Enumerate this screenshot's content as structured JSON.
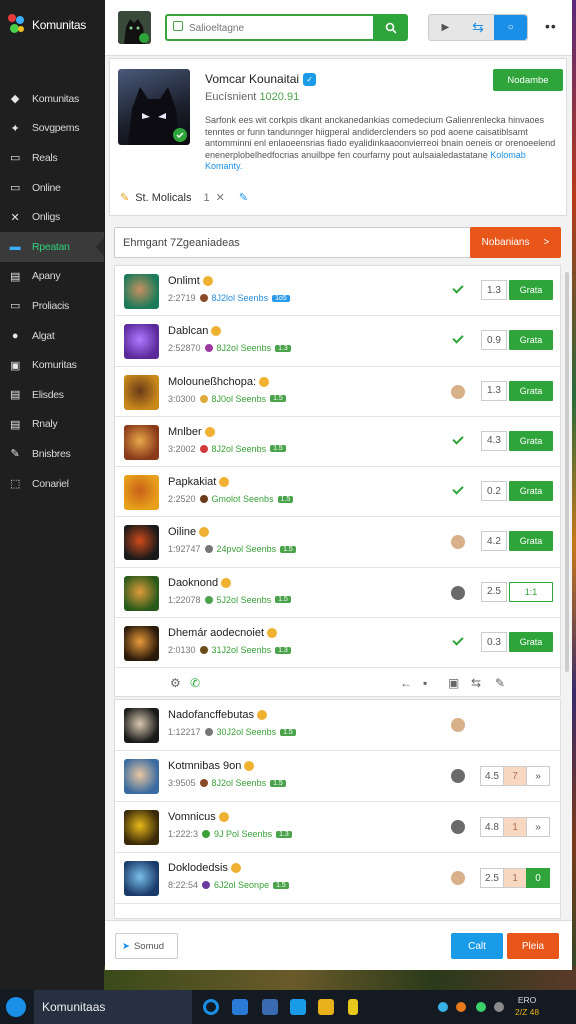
{
  "app": {
    "name": "Komunitas"
  },
  "sidebar": {
    "items": [
      {
        "label": "Komunitas",
        "icon": "pin-icon",
        "glyph": "◆"
      },
      {
        "label": "Sovgpems",
        "icon": "upload-icon",
        "glyph": "✦"
      },
      {
        "label": "Reals",
        "icon": "square-icon",
        "glyph": "▭"
      },
      {
        "label": "Online",
        "icon": "window-icon",
        "glyph": "▭"
      },
      {
        "label": "Onligs",
        "icon": "tools-icon",
        "glyph": "✕"
      },
      {
        "label": "Rpeatan",
        "icon": "card-icon",
        "glyph": "▬",
        "active": true
      },
      {
        "label": "Apany",
        "icon": "list-icon",
        "glyph": "▤"
      },
      {
        "label": "Proliacis",
        "icon": "frame-icon",
        "glyph": "▭"
      },
      {
        "label": "Algat",
        "icon": "circle-icon",
        "glyph": "●"
      },
      {
        "label": "Komuritas",
        "icon": "box-icon",
        "glyph": "▣"
      },
      {
        "label": "Elisdes",
        "icon": "layers-icon",
        "glyph": "▤"
      },
      {
        "label": "Rnaly",
        "icon": "doc-icon",
        "glyph": "▤"
      },
      {
        "label": "Bnisbres",
        "icon": "wand-icon",
        "glyph": "✎"
      },
      {
        "label": "Conariel",
        "icon": "tag-icon",
        "glyph": "⬚"
      }
    ]
  },
  "topbar": {
    "search_placeholder": "Salioeltagne",
    "search_icon": "search-icon",
    "toggle_icons": [
      "play-icon",
      "swap-icon",
      "circle-icon"
    ],
    "more_label": "••"
  },
  "profile": {
    "title": "Vomcar Kounaitai",
    "subtitle_prefix": "Eucísnient",
    "subtitle_value": "1020.91",
    "follow_label": "Nodambe",
    "description": "Sarfonk ees wit corkpis dkant anckanedankias comedecium Galienrenlecka hinvaoes tenntes or funn tandunnger hiigperal andiderclenders so pod aoene caisatiblsamt antomminni enl enlaoeensrias fiado eyalidinkaaoonvierreoi bnain oeneis or orenoeelend enenerplobelhedfocrias anuilbpe fen courfarny pout",
    "description_tail": "aulsaialedastatane",
    "link": "Kolomab Komanty.",
    "stats_label": "St. Molicals",
    "stats_value": "1",
    "stats_close": "✕"
  },
  "filter": {
    "label": "Ehmgant 7Zgeaniadeas",
    "button": "Nobanians",
    "arrow": ">"
  },
  "rows": [
    {
      "name": "Onlimt",
      "time": "2:2719",
      "meta": "8J2lol Seenbs",
      "badge": "1o5",
      "badge_color": "blue",
      "count": "1.3",
      "action": "Grata",
      "status": "check",
      "img": [
        "#1a7a5a",
        "#c89060"
      ],
      "dot": "#8a4a2a"
    },
    {
      "name": "Dablcan",
      "time": "2:52870",
      "meta": "8J2ol Seenbs",
      "badge": "1.3",
      "badge_color": "green",
      "count": "0.9",
      "action": "Grata",
      "status": "check",
      "img": [
        "#5a2a9a",
        "#b07aff"
      ],
      "dot": "#9a3aa0"
    },
    {
      "name": "Molouneßhchopa:",
      "time": "3:0300",
      "meta": "8J0ol Seenbs",
      "badge": "1.5",
      "badge_color": "green",
      "count": "1.3",
      "action": "Grata",
      "status": "face",
      "img": [
        "#c8881a",
        "#6a3a1a"
      ],
      "dot": "#e0aa3a"
    },
    {
      "name": "Mnlber",
      "time": "3:2002",
      "meta": "8J2ol Seenbs",
      "badge": "1.5",
      "badge_color": "green",
      "count": "4.3",
      "action": "Grata",
      "status": "check",
      "img": [
        "#8a3a1a",
        "#e8a84a"
      ],
      "dot": "#d03a3a"
    },
    {
      "name": "Papkakiat",
      "time": "2:2520",
      "meta": "Gmolot Seenbs",
      "badge": "1.5",
      "badge_color": "green",
      "count": "0.2",
      "action": "Grata",
      "status": "check",
      "img": [
        "#e8a01a",
        "#c8601a"
      ],
      "dot": "#6a3a1a"
    },
    {
      "name": "Oiline",
      "time": "1:92747",
      "meta": "24pvol Seenbs",
      "badge": "1.5",
      "badge_color": "green",
      "count": "4.2",
      "action": "Grata",
      "status": "face",
      "img": [
        "#1a1a1a",
        "#d04a1a"
      ],
      "dot": "#777"
    },
    {
      "name": "Daoknond",
      "time": "1:22078",
      "meta": "5J2ol Seenbs",
      "badge": "1.5",
      "badge_color": "green",
      "count": "2.5",
      "action": "1:1",
      "status": "face2",
      "img": [
        "#2a5a1a",
        "#e09a3a"
      ],
      "dot": "#4aa34a"
    },
    {
      "name": "Dhemár aodecnoiet",
      "time": "2:0130",
      "meta": "31J2ol Seenbs",
      "badge": "1.3",
      "badge_color": "green",
      "count": "0.3",
      "action": "Grata",
      "status": "check",
      "img": [
        "#2a1a0a",
        "#e89a3a"
      ],
      "dot": "#6a4a1a"
    }
  ],
  "row_actions": [
    "tools-icon",
    "share-icon",
    "back-icon",
    "delete-icon",
    "export-icon",
    "swap-icon",
    "pin-icon"
  ],
  "rows2": [
    {
      "name": "Nadofancffebutas",
      "time": "1:12217",
      "meta": "30J2ol Seenbs",
      "badge": "1.5",
      "status": "face",
      "img": [
        "#1a1a1a",
        "#d8c8b0"
      ],
      "dot": "#777"
    },
    {
      "name": "Kotmnibas 9on",
      "time": "3:9505",
      "meta": "8J2ol Seenbs",
      "badge": "1.5",
      "status": "face2",
      "count": "4.5",
      "extra": "7",
      "arrow": "»",
      "img": [
        "#3a6aa0",
        "#e8c8a0"
      ],
      "dot": "#8a4a2a"
    },
    {
      "name": "Vomnicus",
      "time": "1:222:3",
      "meta": "9J Pol Seenbs",
      "badge": "1.3",
      "status": "face2",
      "count": "4.8",
      "extra": "1",
      "arrow": "»",
      "img": [
        "#3a2a0a",
        "#e8b81a"
      ],
      "dot": "#3aa03a"
    },
    {
      "name": "Doklodedsis",
      "time": "8:22:54",
      "meta": "6J2ol Seonpe",
      "badge": "1.5",
      "status": "face",
      "count": "2.5",
      "extra": "1",
      "go": "0",
      "img": [
        "#1a3a6a",
        "#7ac0e8"
      ],
      "dot": "#6a3aa0"
    }
  ],
  "footer": {
    "send_label": "Somud",
    "cancel_label": "Calt",
    "submit_label": "Pleia"
  },
  "colors": {
    "accent_green": "#2ea43a",
    "accent_blue": "#1a8fe8",
    "accent_orange": "#e8561a"
  },
  "taskbar": {
    "app_label": "Komunitaas",
    "time": "ERO",
    "date": "2/Z 48"
  }
}
